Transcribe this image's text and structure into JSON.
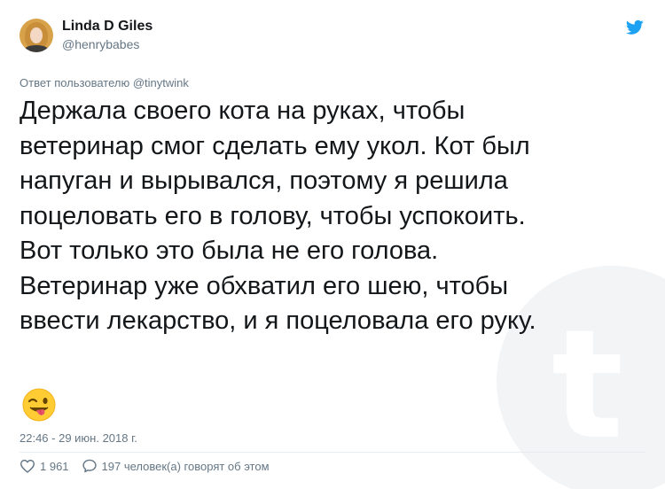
{
  "author": {
    "display_name": "Linda D Giles",
    "handle": "@henrybabes"
  },
  "reply_to": "Ответ пользователю @tinytwink",
  "tweet_lines": [
    "Держала своего кота на руках, чтобы",
    "ветеринар смог сделать ему укол. Кот был",
    "напуган и вырывался, поэтому я решила",
    "поцеловать его в голову, чтобы успокоить.",
    "Вот только это была не его голова.",
    "Ветеринар уже обхватил его шею, чтобы",
    "ввести лекарство, и я поцеловала его руку."
  ],
  "emoji": "winking-face-with-tongue",
  "timestamp": "22:46 - 29 июн. 2018 г.",
  "stats": {
    "likes": "1 961",
    "replies_label": "197 человек(а) говорят об этом"
  },
  "colors": {
    "twitter_blue": "#1da1f2",
    "text": "#14171a",
    "muted": "#657786"
  }
}
